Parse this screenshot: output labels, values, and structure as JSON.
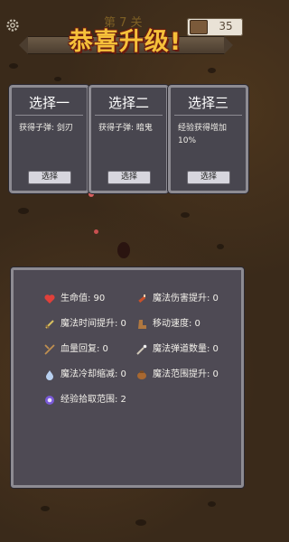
{
  "header": {
    "title": "恭喜升级!",
    "title_ghost": "第 7 关",
    "coins": "35",
    "settings_icon": "gear-icon",
    "coin_icon": "treasure-chest-icon"
  },
  "choices": [
    {
      "title": "选择一",
      "desc": "获得子弹: 剑刃",
      "button": "选择"
    },
    {
      "title": "选择二",
      "desc": "获得子弹: 暗鬼",
      "button": "选择"
    },
    {
      "title": "选择三",
      "desc": "经验获得增加10%",
      "button": "选择"
    }
  ],
  "stats": {
    "items": [
      {
        "label": "生命值: 90",
        "icon": "heart-icon",
        "color": "#e0403a"
      },
      {
        "label": "魔法伤害提升: 0",
        "icon": "potion-icon",
        "color": "#c8502a"
      },
      {
        "label": "魔法时间提升: 0",
        "icon": "sword-icon",
        "color": "#d8c060"
      },
      {
        "label": "移动速度: 0",
        "icon": "boot-icon",
        "color": "#b07840"
      },
      {
        "label": "血量回复: 0",
        "icon": "crossed-swords-icon",
        "color": "#c09050"
      },
      {
        "label": "魔法弹道数量: 0",
        "icon": "magic-wand-icon",
        "color": "#d0c8b8"
      },
      {
        "label": "魔法冷却缩减: 0",
        "icon": "water-drop-icon",
        "color": "#b8d0f0"
      },
      {
        "label": "魔法范围提升: 0",
        "icon": "pouch-icon",
        "color": "#a86830"
      },
      {
        "label": "经验拾取范围: 2",
        "icon": "magnet-orb-icon",
        "color": "#7a5ad8"
      }
    ]
  },
  "colors": {
    "background": "#3a2a1a",
    "panel": "#48464f",
    "panel_border": "#8d8b92",
    "title": "#f6c03a"
  }
}
